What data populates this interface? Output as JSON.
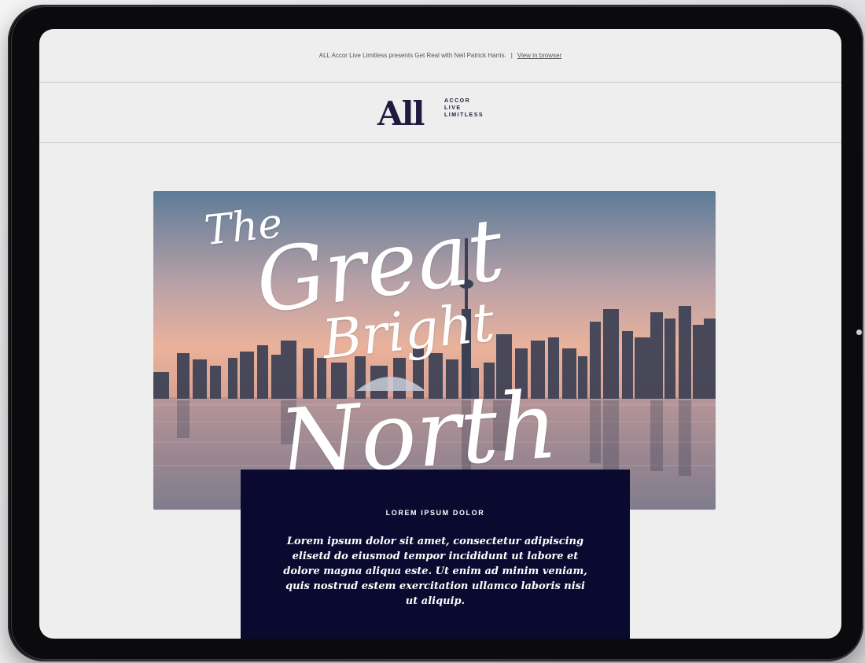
{
  "preheader": {
    "text": "ALL Accor Live Limitless presents Get Real with Neil Patrick Harris.",
    "separator": "|",
    "view_in_browser": "View in browser"
  },
  "logo": {
    "wordmark": "All",
    "tagline": [
      "ACCOR",
      "LIVE",
      "LIMITLESS"
    ]
  },
  "hero": {
    "script_lines": [
      "The",
      "Great",
      "Bright",
      "North"
    ]
  },
  "card": {
    "eyebrow": "LOREM IPSUM DOLOR",
    "body": "Lorem ipsum dolor sit amet, consectetur adipiscing elisetd do eiusmod tempor incididunt ut labore et dolore magna aliqua este. Ut enim ad minim veniam, quis nostrud estem exercitation ullamco laboris nisi ut aliquip."
  },
  "colors": {
    "brand_navy": "#0a0930",
    "logo_ink": "#1e1b3f",
    "screen_bg": "#eeeeef"
  }
}
